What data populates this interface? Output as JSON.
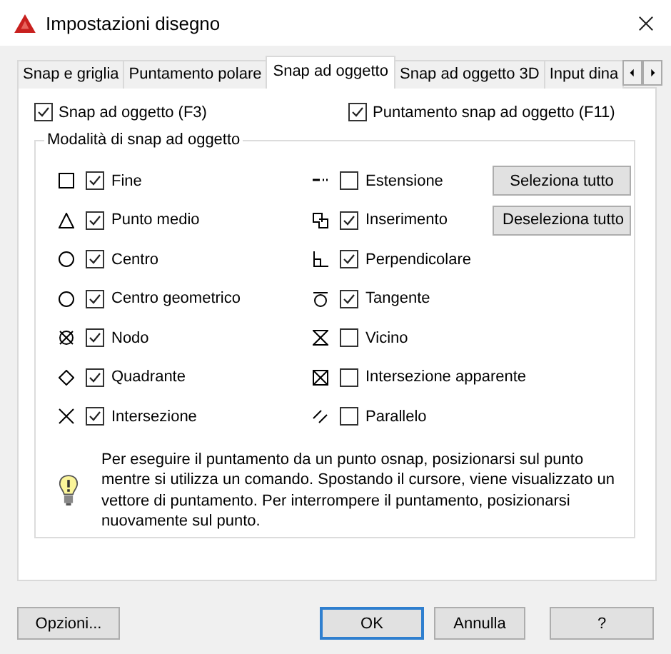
{
  "window": {
    "title": "Impostazioni disegno"
  },
  "tabs": [
    {
      "label": "Snap e griglia",
      "selected": false
    },
    {
      "label": "Puntamento polare",
      "selected": false
    },
    {
      "label": "Snap ad oggetto",
      "selected": true
    },
    {
      "label": "Snap ad oggetto 3D",
      "selected": false
    },
    {
      "label": "Input dina",
      "selected": false
    }
  ],
  "top_options": [
    {
      "label": "Snap ad oggetto (F3)",
      "checked": true
    },
    {
      "label": "Puntamento snap ad oggetto (F11)",
      "checked": true
    }
  ],
  "group": {
    "title": "Modalità di snap ad oggetto",
    "modes": [
      {
        "label": "Fine",
        "checked": true
      },
      {
        "label": "Punto medio",
        "checked": true
      },
      {
        "label": "Centro",
        "checked": true
      },
      {
        "label": "Centro geometrico",
        "checked": true
      },
      {
        "label": "Nodo",
        "checked": true
      },
      {
        "label": "Quadrante",
        "checked": true
      },
      {
        "label": "Intersezione",
        "checked": true
      },
      {
        "label": "Estensione",
        "checked": false
      },
      {
        "label": "Inserimento",
        "checked": true
      },
      {
        "label": "Perpendicolare",
        "checked": true
      },
      {
        "label": "Tangente",
        "checked": true
      },
      {
        "label": "Vicino",
        "checked": false
      },
      {
        "label": "Intersezione apparente",
        "checked": false
      },
      {
        "label": "Parallelo",
        "checked": false
      }
    ],
    "buttons": [
      "Seleziona tutto",
      "Deseleziona tutto"
    ]
  },
  "info": "Per eseguire il puntamento da un punto osnap, posizionarsi sul punto mentre si utilizza un comando. Spostando il cursore, viene visualizzato un vettore di puntamento. Per interrompere il puntamento, posizionarsi nuovamente sul punto.",
  "footer": {
    "left_button": "Opzioni...",
    "buttons": [
      {
        "label": "OK",
        "default": true
      },
      {
        "label": "Annulla",
        "default": false
      },
      {
        "label": "?",
        "default": false
      }
    ]
  }
}
